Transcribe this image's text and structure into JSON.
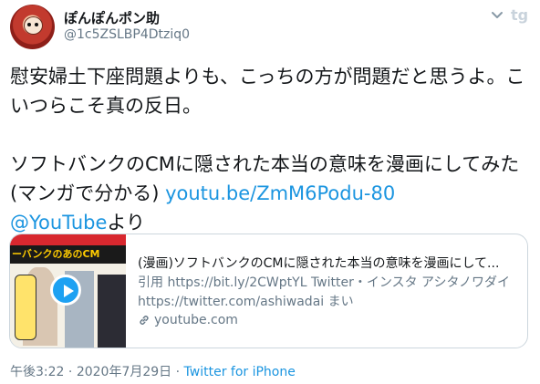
{
  "author": {
    "name": "ぽんぽんポン助",
    "handle": "@1c5ZSLBP4Dtziq0"
  },
  "tweet": {
    "line1": "慰安婦土下座問題よりも、こっちの方が問題だと思うよ。こいつらこそ真の反日。",
    "line2_text": "ソフトバンクのCMに隠された本当の意味を漫画にしてみた(マンガで分かる) ",
    "line2_link": "youtu.be/ZmM6Podu-80",
    "line3_mention": "@YouTube",
    "line3_suffix": "より"
  },
  "card": {
    "thumbnail_caption": "ーバンクのあのCM",
    "title": "(漫画)ソフトバンクのCMに隠された本当の意味を漫画にして...",
    "description": "引用 https://bit.ly/2CWptYL Twitter・インスタ アシタノワダイ https://twitter.com/ashiwadai まい",
    "domain": "youtube.com"
  },
  "footer": {
    "time": "午後3:22",
    "separator1": " · ",
    "date": "2020年7月29日",
    "separator2": " · ",
    "source": "Twitter for iPhone"
  },
  "icons": {
    "caret": "chevron-down-icon",
    "logo": "twitter-logo-icon",
    "link": "link-icon",
    "play": "play-icon"
  },
  "colors": {
    "link": "#1b95e0",
    "muted": "#657786",
    "text": "#14171a",
    "play": "#1da1f2"
  }
}
